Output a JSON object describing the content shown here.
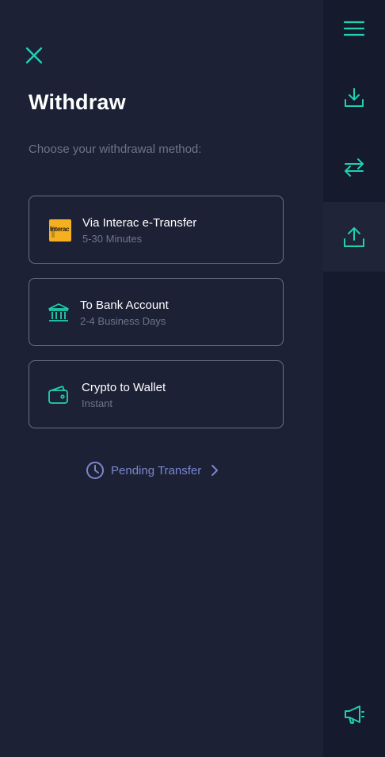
{
  "page": {
    "title": "Withdraw",
    "subtitle": "Choose your withdrawal method:"
  },
  "methods": [
    {
      "label": "Via Interac e-Transfer",
      "sub": "5-30 Minutes",
      "icon": "interac-logo",
      "logo_text": "Interac"
    },
    {
      "label": "To Bank Account",
      "sub": "2-4 Business Days",
      "icon": "bank-icon"
    },
    {
      "label": "Crypto to Wallet",
      "sub": "Instant",
      "icon": "wallet-icon"
    }
  ],
  "pending": {
    "label": "Pending Transfer",
    "icon": "clock-icon"
  },
  "rail": {
    "items": [
      "menu-icon",
      "deposit-icon",
      "transfer-icon",
      "withdraw-icon",
      "announcement-icon"
    ],
    "active": "withdraw-icon"
  },
  "colors": {
    "background": "#1c2136",
    "rail_background": "#151b2d",
    "accent": "#1fd1b2",
    "link": "#7b87cc",
    "muted_text": "#6f7589",
    "card_border": "#6b7083",
    "interac_yellow": "#f5b020"
  }
}
